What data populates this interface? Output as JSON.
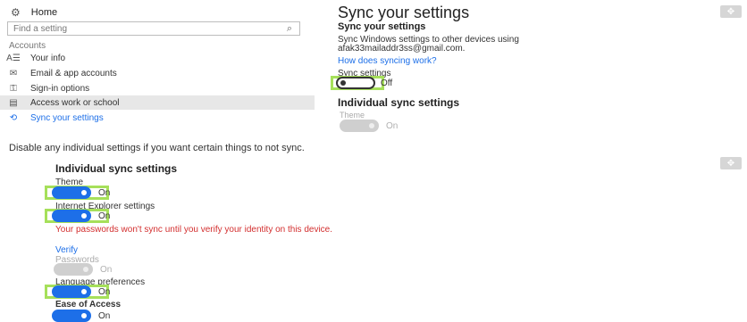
{
  "sidebar": {
    "home_label": "Home",
    "search_placeholder": "Find a setting",
    "section_label": "Accounts",
    "items": [
      {
        "label": "Your info"
      },
      {
        "label": "Email & app accounts"
      },
      {
        "label": "Sign-in options"
      },
      {
        "label": "Access work or school"
      },
      {
        "label": "Sync your settings"
      }
    ]
  },
  "main": {
    "page_title": "Sync your settings",
    "subtitle": "Sync your settings",
    "description": "Sync Windows settings to other devices using afak33mailaddr3ss@gmail.com.",
    "help_link": "How does syncing work?",
    "sync_settings_label": "Sync settings",
    "sync_state": "Off",
    "individual_heading": "Individual sync settings",
    "theme_label": "Theme",
    "theme_state": "On"
  },
  "caption": "Disable any individual settings if you want certain things to not sync.",
  "detail": {
    "heading": "Individual sync settings",
    "items": [
      {
        "label": "Theme",
        "state": "On"
      },
      {
        "label": "Internet Explorer settings",
        "state": "On"
      },
      {
        "label": "Passwords",
        "state": "On"
      },
      {
        "label": "Language preferences",
        "state": "On"
      },
      {
        "label": "Ease of Access",
        "state": "On"
      }
    ],
    "warning": "Your passwords won't sync until you verify your identity on this device.",
    "verify_link": "Verify"
  },
  "colors": {
    "accent": "#1d6fe8",
    "highlight": "#a6e05a",
    "warning": "#d32f2f"
  }
}
